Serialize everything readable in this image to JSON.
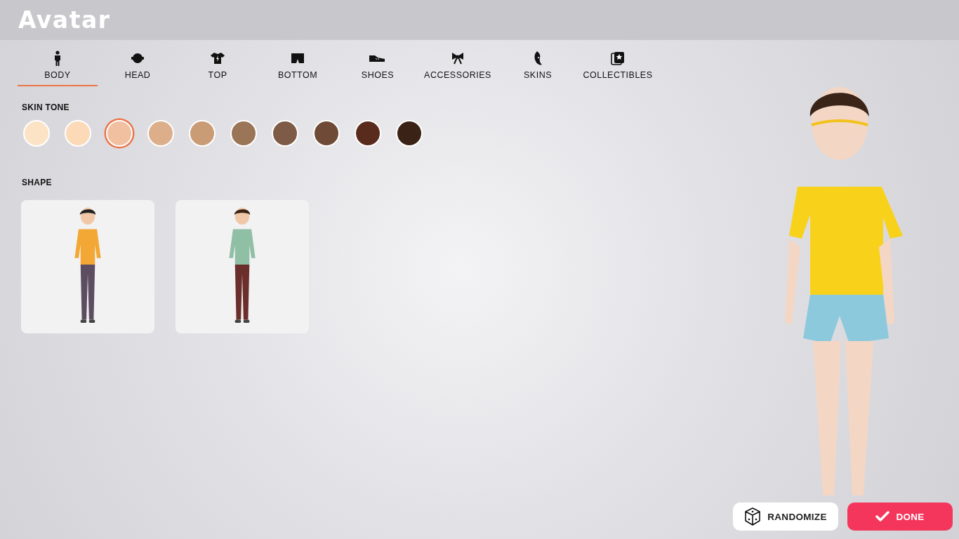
{
  "header": {
    "title": "Avatar"
  },
  "tabs": [
    {
      "label": "BODY",
      "selected": true
    },
    {
      "label": "HEAD",
      "selected": false
    },
    {
      "label": "TOP",
      "selected": false
    },
    {
      "label": "BOTTOM",
      "selected": false
    },
    {
      "label": "SHOES",
      "selected": false
    },
    {
      "label": "ACCESSORIES",
      "selected": false
    },
    {
      "label": "SKINS",
      "selected": false
    },
    {
      "label": "COLLECTIBLES",
      "selected": false
    }
  ],
  "skin_tone": {
    "label": "SKIN TONE",
    "swatches": [
      {
        "color": "#fde3c6",
        "selected": false
      },
      {
        "color": "#fcd9b7",
        "selected": false
      },
      {
        "color": "#f0c0a0",
        "selected": true
      },
      {
        "color": "#dcae8a",
        "selected": false
      },
      {
        "color": "#c99c76",
        "selected": false
      },
      {
        "color": "#9a7558",
        "selected": false
      },
      {
        "color": "#7e5b46",
        "selected": false
      },
      {
        "color": "#6f4a36",
        "selected": false
      },
      {
        "color": "#592b1d",
        "selected": false
      },
      {
        "color": "#3b2216",
        "selected": false
      }
    ]
  },
  "shape": {
    "label": "SHAPE",
    "options": [
      {
        "kind": "feminine"
      },
      {
        "kind": "masculine"
      }
    ]
  },
  "buttons": [
    {
      "kind": "randomize",
      "label": "RANDOMIZE"
    },
    {
      "kind": "done",
      "label": "DONE"
    }
  ]
}
